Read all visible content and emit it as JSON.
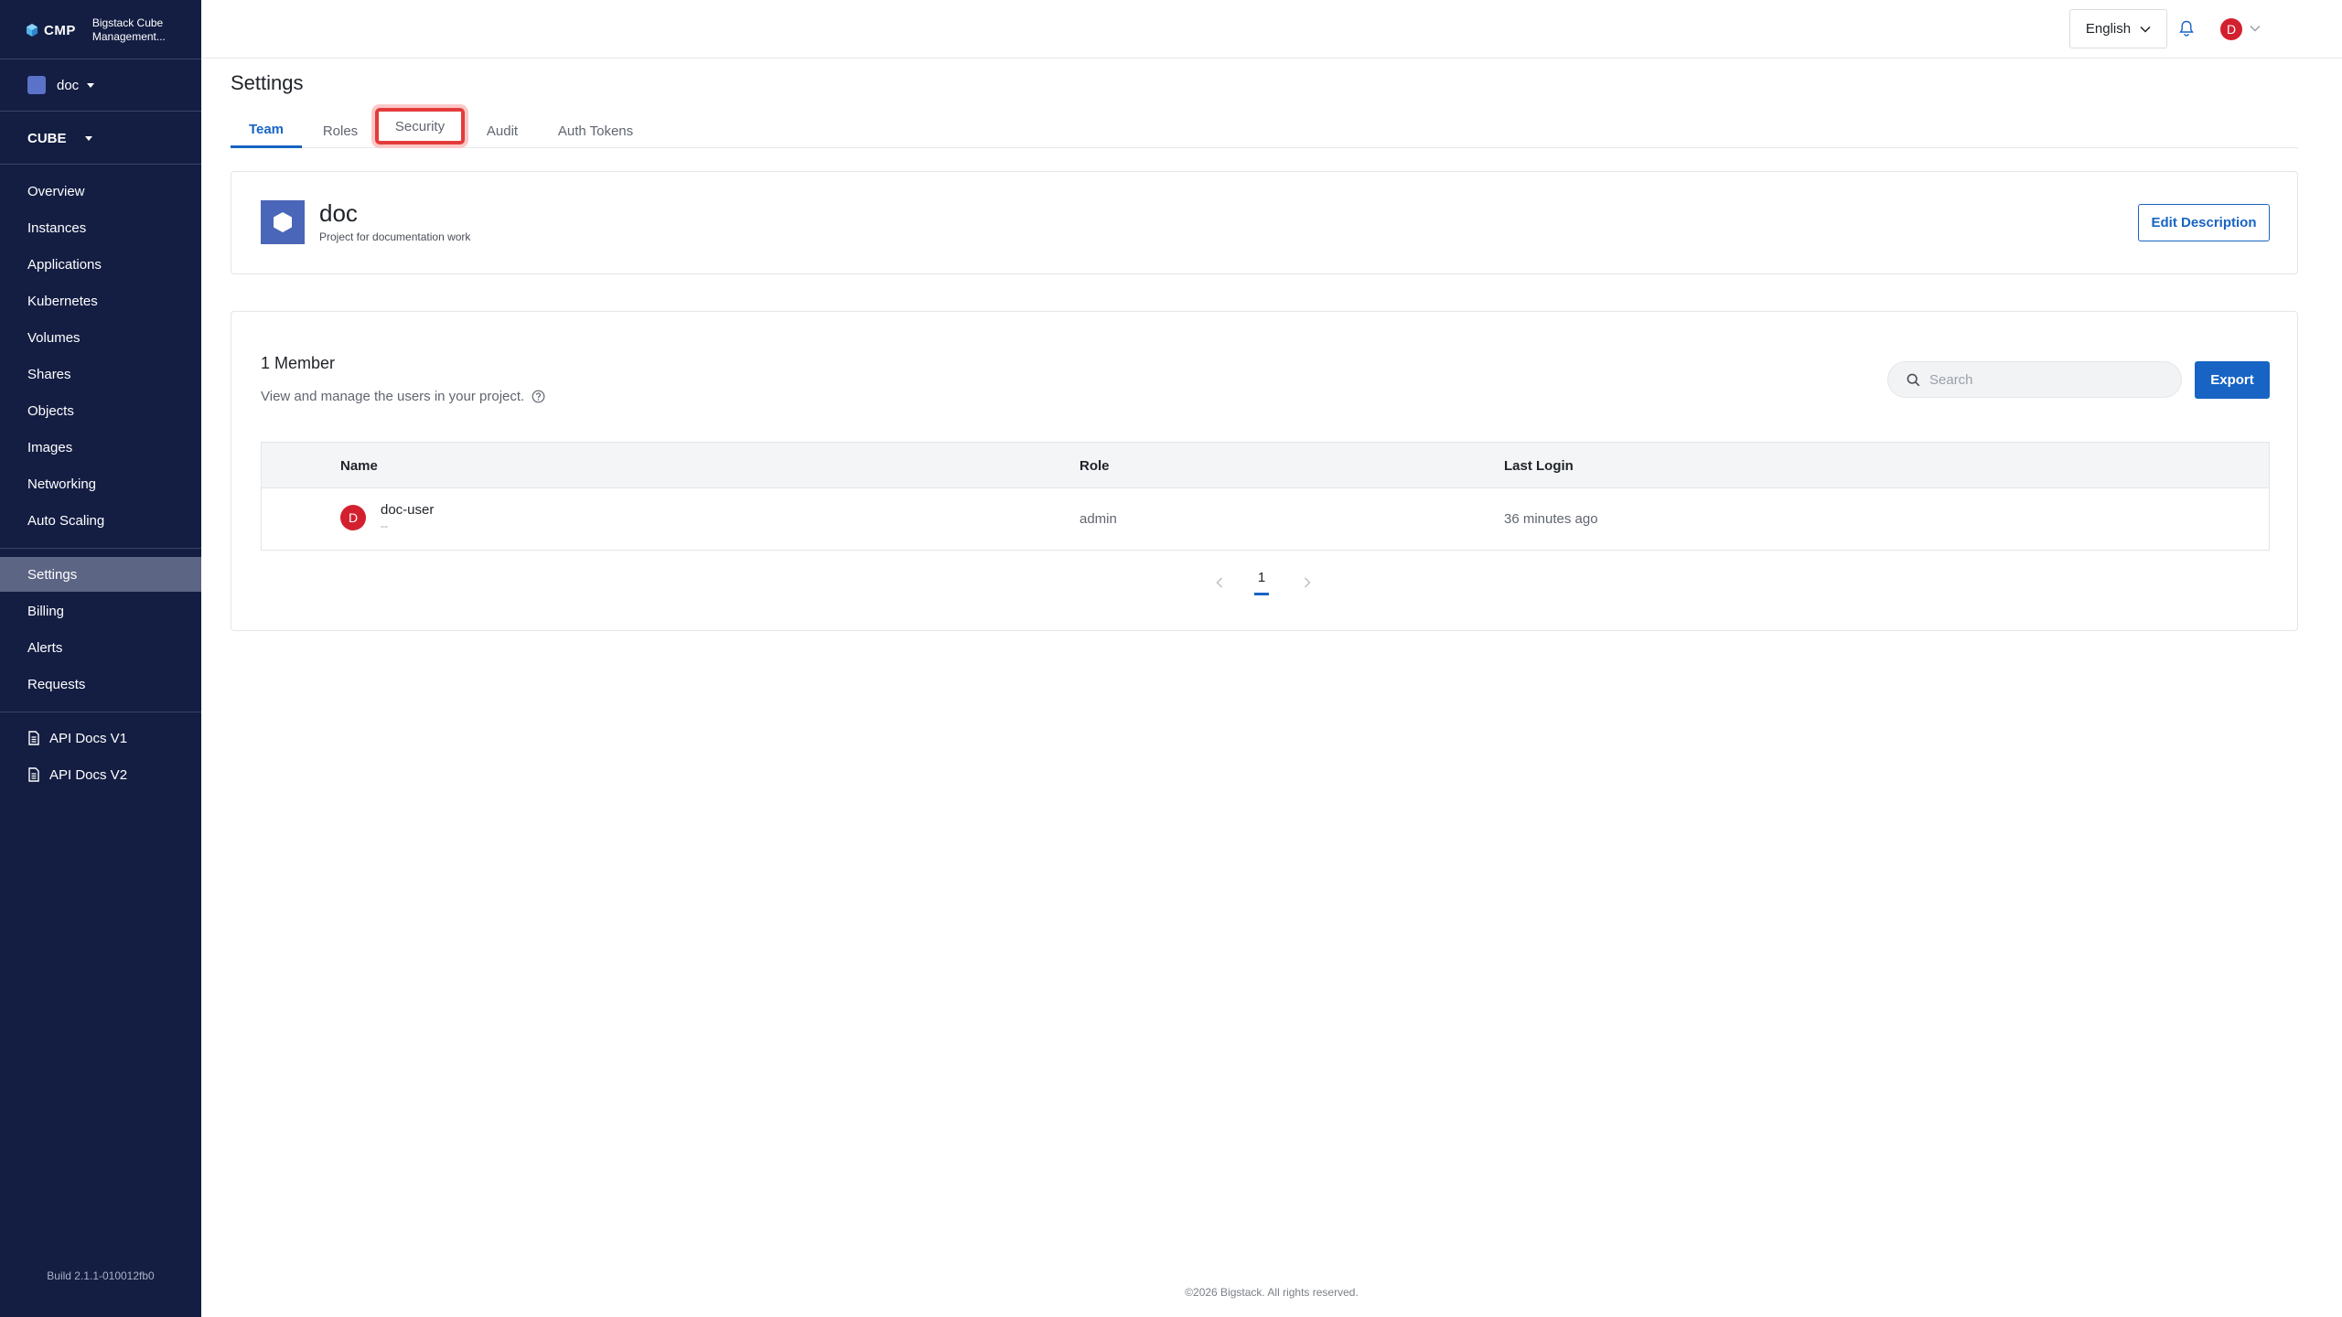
{
  "brand": {
    "short": "CMP",
    "name": "Bigstack Cube Management..."
  },
  "project_selector": {
    "label": "doc"
  },
  "region_selector": {
    "label": "CUBE"
  },
  "sidebar": {
    "items": [
      {
        "label": "Overview"
      },
      {
        "label": "Instances"
      },
      {
        "label": "Applications"
      },
      {
        "label": "Kubernetes"
      },
      {
        "label": "Volumes"
      },
      {
        "label": "Shares"
      },
      {
        "label": "Objects"
      },
      {
        "label": "Images"
      },
      {
        "label": "Networking"
      },
      {
        "label": "Auto Scaling"
      }
    ],
    "admin_items": [
      {
        "label": "Settings",
        "active": true
      },
      {
        "label": "Billing"
      },
      {
        "label": "Alerts"
      },
      {
        "label": "Requests"
      }
    ],
    "doc_items": [
      {
        "label": "API Docs V1",
        "icon": "document-icon"
      },
      {
        "label": "API Docs V2",
        "icon": "document-icon"
      }
    ],
    "build": "Build 2.1.1-010012fb0"
  },
  "topbar": {
    "language": "English",
    "user_initial": "D"
  },
  "page": {
    "title": "Settings",
    "tabs": [
      {
        "label": "Team",
        "active": true
      },
      {
        "label": "Roles"
      },
      {
        "label": "Security",
        "highlighted": true
      },
      {
        "label": "Audit"
      },
      {
        "label": "Auth Tokens"
      }
    ]
  },
  "project": {
    "name": "doc",
    "description": "Project for documentation work",
    "edit_label": "Edit Description"
  },
  "members": {
    "title": "1 Member",
    "subtitle": "View and manage the users in your project.",
    "search_placeholder": "Search",
    "export_label": "Export",
    "columns": [
      "Name",
      "Role",
      "Last Login"
    ],
    "rows": [
      {
        "initial": "D",
        "name": "doc-user",
        "sub": "--",
        "role": "admin",
        "last_login": "36 minutes ago"
      }
    ],
    "page": "1"
  },
  "footer": "©2026 Bigstack. All rights reserved.",
  "colors": {
    "sidebar": "#141e43",
    "accent": "#1764c4",
    "avatar": "#d3202f",
    "highlight": "#e33b3b"
  }
}
